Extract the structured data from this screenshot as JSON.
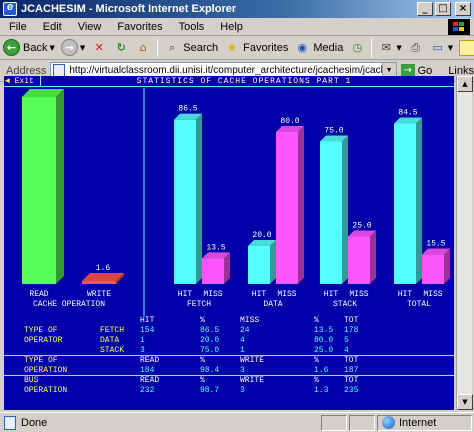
{
  "window": {
    "title": "JCACHESIM - Microsoft Internet Explorer",
    "minimize": "_",
    "maximize": "□",
    "close": "×"
  },
  "menu": [
    "File",
    "Edit",
    "View",
    "Favorites",
    "Tools",
    "Help"
  ],
  "toolbar": {
    "back": "Back",
    "search": "Search",
    "favorites": "Favorites",
    "media": "Media"
  },
  "address": {
    "label": "Address",
    "value": "http://virtualclassroom.dii.unisi.it/computer_architecture/jcachesim/jcachesim.html",
    "go": "Go",
    "links": "Links"
  },
  "sim": {
    "exit": "Exit",
    "title": "STATISTICS OF CACHE OPERATIONS PART 1"
  },
  "chart_data": {
    "type": "bar",
    "title": "STATISTICS OF CACHE OPERATIONS PART 1",
    "ylim": [
      0,
      100
    ],
    "groups": [
      {
        "label": "CACHE OPERATION",
        "bars": [
          {
            "label": "READ",
            "value": 98.4,
            "color": "#55ff55"
          },
          {
            "label": "WRITE",
            "value": 1.6,
            "color": "#ff5555"
          }
        ]
      },
      {
        "label": "FETCH",
        "bars": [
          {
            "label": "HIT",
            "value": 86.5,
            "color": "#55ffff"
          },
          {
            "label": "MISS",
            "value": 13.5,
            "color": "#ff55ff"
          }
        ]
      },
      {
        "label": "DATA",
        "bars": [
          {
            "label": "HIT",
            "value": 20.0,
            "color": "#55ffff"
          },
          {
            "label": "MISS",
            "value": 80.0,
            "color": "#ff55ff"
          }
        ]
      },
      {
        "label": "STACK",
        "bars": [
          {
            "label": "HIT",
            "value": 75.0,
            "color": "#55ffff"
          },
          {
            "label": "MISS",
            "value": 25.0,
            "color": "#ff55ff"
          }
        ]
      },
      {
        "label": "TOTAL",
        "bars": [
          {
            "label": "HIT",
            "value": 84.5,
            "color": "#55ffff"
          },
          {
            "label": "MISS",
            "value": 15.5,
            "color": "#ff55ff"
          }
        ]
      }
    ]
  },
  "stats": {
    "header": [
      "HIT",
      "%",
      "MISS",
      "%",
      "TOT"
    ],
    "rows": [
      {
        "label1": "TYPE OF",
        "label2": "FETCH",
        "v": [
          "154",
          "86.5",
          "24",
          "13.5",
          "178"
        ]
      },
      {
        "label1": "OPERATOR",
        "label2": "DATA",
        "v": [
          "1",
          "20.0",
          "4",
          "80.0",
          "5"
        ]
      },
      {
        "label1": "",
        "label2": "STACK",
        "v": [
          "3",
          "75.0",
          "1",
          "25.0",
          "4"
        ]
      }
    ],
    "op_header": {
      "label1": "TYPE OF",
      "label2": "OPERATION",
      "cols": [
        "READ",
        "%",
        "WRITE",
        "%",
        "TOT"
      ],
      "v": [
        "184",
        "98.4",
        "3",
        "1.6",
        "187"
      ]
    },
    "bus_header": {
      "label1": "BUS",
      "label2": "OPERATION",
      "cols": [
        "READ",
        "%",
        "WRITE",
        "%",
        "TOT"
      ],
      "v": [
        "232",
        "98.7",
        "3",
        "1.3",
        "235"
      ]
    }
  },
  "status": {
    "text": "Done",
    "zone": "Internet"
  }
}
